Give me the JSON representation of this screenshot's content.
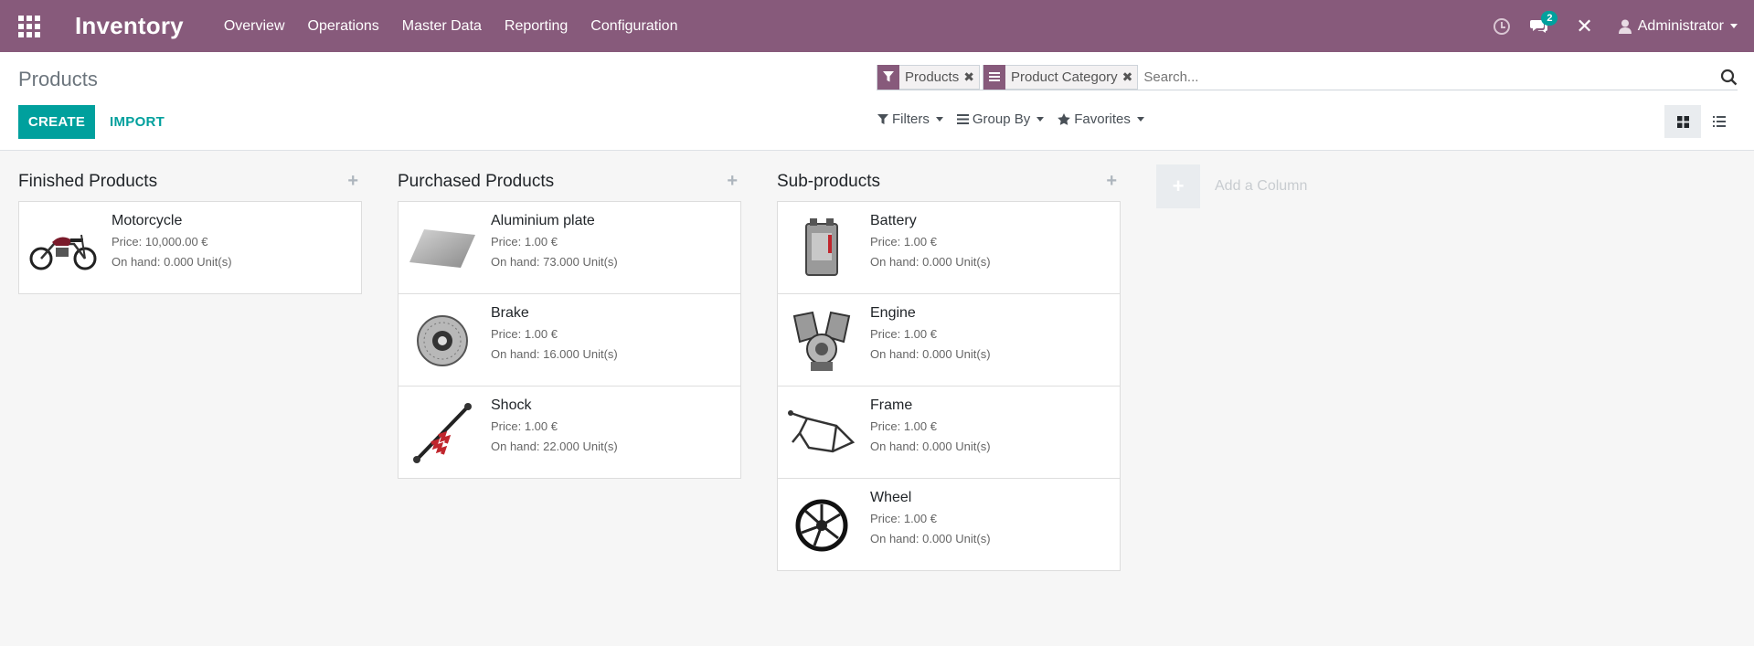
{
  "navbar": {
    "app_title": "Inventory",
    "menu": [
      "Overview",
      "Operations",
      "Master Data",
      "Reporting",
      "Configuration"
    ],
    "chat_badge": "2",
    "user_name": "Administrator",
    "bg_color": "#875a7b"
  },
  "control_panel": {
    "breadcrumb": "Products",
    "create_label": "CREATE",
    "import_label": "IMPORT",
    "search": {
      "facets": [
        {
          "icon": "filter-icon",
          "label": "Products"
        },
        {
          "icon": "group-by-icon",
          "label": "Product Category"
        }
      ],
      "placeholder": "Search..."
    },
    "options": {
      "filters": "Filters",
      "group_by": "Group By",
      "favorites": "Favorites"
    },
    "views": [
      "kanban-view",
      "list-view"
    ],
    "active_view": "kanban-view",
    "accent_color": "#00a09d"
  },
  "kanban": {
    "columns": [
      {
        "title": "Finished Products",
        "cards": [
          {
            "name": "Motorcycle",
            "price": "Price: 10,000.00 €",
            "on_hand": "On hand: 0.000 Unit(s)",
            "image": "motorcycle"
          }
        ]
      },
      {
        "title": "Purchased Products",
        "cards": [
          {
            "name": "Aluminium plate",
            "price": "Price: 1.00 €",
            "on_hand": "On hand: 73.000 Unit(s)",
            "image": "plate"
          },
          {
            "name": "Brake",
            "price": "Price: 1.00 €",
            "on_hand": "On hand: 16.000 Unit(s)",
            "image": "brake-disc"
          },
          {
            "name": "Shock",
            "price": "Price: 1.00 €",
            "on_hand": "On hand: 22.000 Unit(s)",
            "image": "shock"
          }
        ]
      },
      {
        "title": "Sub-products",
        "cards": [
          {
            "name": "Battery",
            "price": "Price: 1.00 €",
            "on_hand": "On hand: 0.000 Unit(s)",
            "image": "battery"
          },
          {
            "name": "Engine",
            "price": "Price: 1.00 €",
            "on_hand": "On hand: 0.000 Unit(s)",
            "image": "engine"
          },
          {
            "name": "Frame",
            "price": "Price: 1.00 €",
            "on_hand": "On hand: 0.000 Unit(s)",
            "image": "frame"
          },
          {
            "name": "Wheel",
            "price": "Price: 1.00 €",
            "on_hand": "On hand: 0.000 Unit(s)",
            "image": "wheel"
          }
        ]
      }
    ],
    "add_column_label": "Add a Column"
  }
}
